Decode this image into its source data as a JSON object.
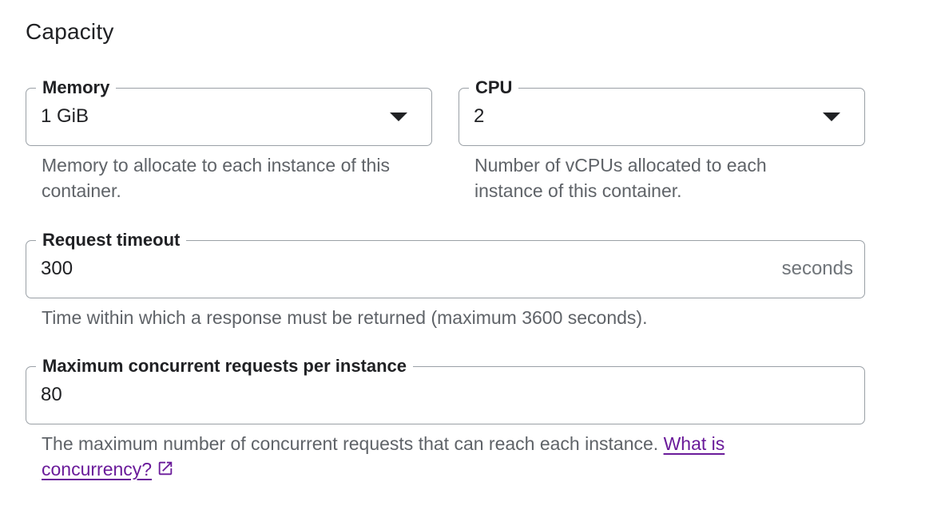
{
  "section": {
    "title": "Capacity"
  },
  "memory": {
    "label": "Memory",
    "value": "1 GiB",
    "helper": "Memory to allocate to each instance of this container."
  },
  "cpu": {
    "label": "CPU",
    "value": "2",
    "helper": "Number of vCPUs allocated to each instance of this container."
  },
  "request_timeout": {
    "label": "Request timeout",
    "value": "300",
    "suffix": "seconds",
    "helper": "Time within which a response must be returned (maximum 3600 seconds)."
  },
  "max_concurrent": {
    "label": "Maximum concurrent requests per instance",
    "value": "80",
    "helper": "The maximum number of concurrent requests that can reach each instance.",
    "link_text": "What is concurrency?",
    "link_icon": "open-in-new-icon"
  },
  "colors": {
    "link": "#6a1b9a",
    "border": "#9aa0a6",
    "helper_text": "#5f6368"
  }
}
